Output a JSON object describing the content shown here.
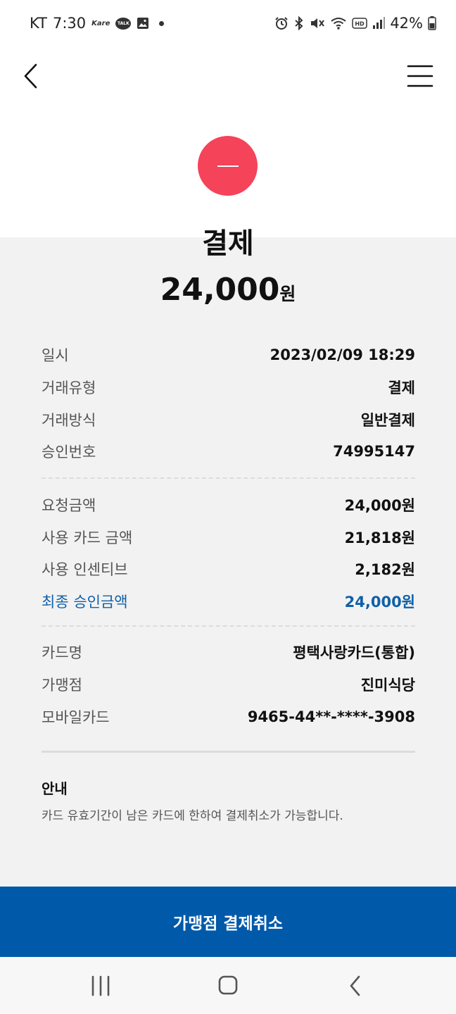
{
  "status_bar": {
    "carrier": "KT",
    "time": "7:30",
    "kare_label": "Kare",
    "talk_label": "TALK",
    "hd_label": "HD",
    "battery": "42%",
    "icons": [
      "kare-logo",
      "kakaotalk-icon",
      "gallery-icon",
      "notification-dot",
      "alarm-icon",
      "bluetooth-icon",
      "mute-icon",
      "wifi-icon",
      "hd-icon",
      "signal-icon",
      "battery-icon"
    ]
  },
  "header": {
    "back_icon": "chevron-left-icon",
    "menu_icon": "hamburger-menu-icon"
  },
  "status": {
    "icon": "minus-icon",
    "color": "#f5435a"
  },
  "transaction": {
    "title": "결제",
    "amount": "24,000",
    "unit": "원"
  },
  "details_group1": [
    {
      "label": "일시",
      "value": "2023/02/09 18:29"
    },
    {
      "label": "거래유형",
      "value": "결제"
    },
    {
      "label": "거래방식",
      "value": "일반결제"
    },
    {
      "label": "승인번호",
      "value": "74995147"
    }
  ],
  "details_group2": [
    {
      "label": "요청금액",
      "value": "24,000원"
    },
    {
      "label": "사용 카드 금액",
      "value": "21,818원"
    },
    {
      "label": "사용 인센티브",
      "value": "2,182원"
    },
    {
      "label": "최종 승인금액",
      "value": "24,000원"
    }
  ],
  "details_group3": [
    {
      "label": "카드명",
      "value": "평택사랑카드(통합)"
    },
    {
      "label": "가맹점",
      "value": "진미식당"
    },
    {
      "label": "모바일카드",
      "value": "9465-44**-****-3908"
    }
  ],
  "notice": {
    "title": "안내",
    "text": "카드 유효기간이 남은 카드에 한하여 결제취소가 가능합니다."
  },
  "actions": {
    "cancel_label": "가맹점 결제취소"
  },
  "colors": {
    "accent_blue": "#0059a9",
    "highlight_text": "#1060a8",
    "status_red": "#f5435a",
    "background_grey": "#f2f2f2"
  },
  "nav": {
    "icons": [
      "recent-apps-icon",
      "home-icon",
      "back-icon"
    ]
  }
}
